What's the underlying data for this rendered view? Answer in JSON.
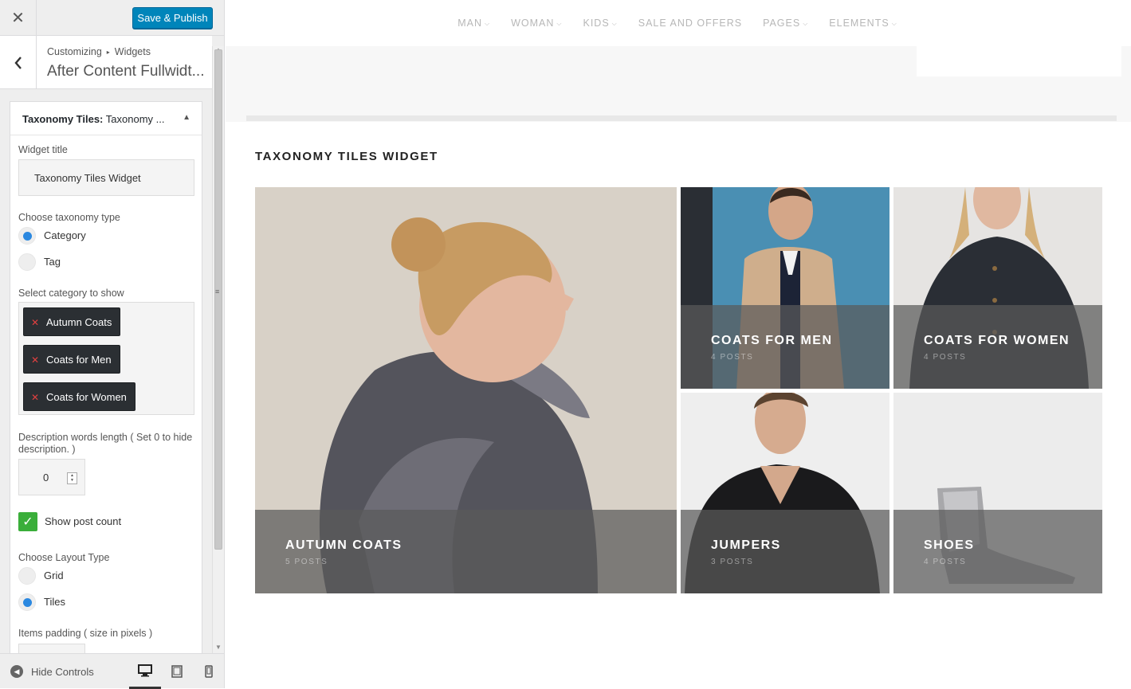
{
  "customizer": {
    "close_icon": "close-icon",
    "publish_label": "Save & Publish",
    "breadcrumb": {
      "part1": "Customizing",
      "sep": "▸",
      "part2": "Widgets"
    },
    "section_title": "After Content Fullwidt...",
    "widget": {
      "header_bold": "Taxonomy Tiles:",
      "header_rest": " Taxonomy ...",
      "widget_title_label": "Widget title",
      "widget_title_value": "Taxonomy Tiles Widget",
      "taxonomy_label": "Choose taxonomy type",
      "taxonomy_options": [
        "Category",
        "Tag"
      ],
      "taxonomy_selected": "Category",
      "category_label": "Select category to show",
      "selected_categories": [
        "Autumn Coats",
        "Coats for Men",
        "Coats for Women"
      ],
      "desc_length_label": "Description words length ( Set 0 to hide description. )",
      "desc_length_value": "0",
      "show_post_count_label": "Show post count",
      "show_post_count": true,
      "layout_label": "Choose Layout Type",
      "layout_options": [
        "Grid",
        "Tiles"
      ],
      "layout_selected": "Tiles",
      "padding_label": "Items padding ( size in pixels )"
    },
    "footer": {
      "hide_controls_label": "Hide Controls",
      "devices": [
        "desktop",
        "tablet",
        "mobile"
      ],
      "active_device": "desktop"
    }
  },
  "preview": {
    "nav": [
      "MAN",
      "WOMAN",
      "KIDS",
      "SALE AND OFFERS",
      "PAGES",
      "ELEMENTS"
    ],
    "widget_heading": "TAXONOMY TILES WIDGET",
    "tiles": [
      {
        "name": "AUTUMN COATS",
        "count": "5 POSTS"
      },
      {
        "name": "COATS FOR MEN",
        "count": "4 POSTS"
      },
      {
        "name": "COATS FOR WOMEN",
        "count": "4 POSTS"
      },
      {
        "name": "JUMPERS",
        "count": "3 POSTS"
      },
      {
        "name": "SHOES",
        "count": "4 POSTS"
      }
    ]
  },
  "colors": {
    "publish": "#0085ba",
    "radio_on": "#2b88e0",
    "checkbox": "#3aae3a",
    "chip": "#2b2f33"
  }
}
